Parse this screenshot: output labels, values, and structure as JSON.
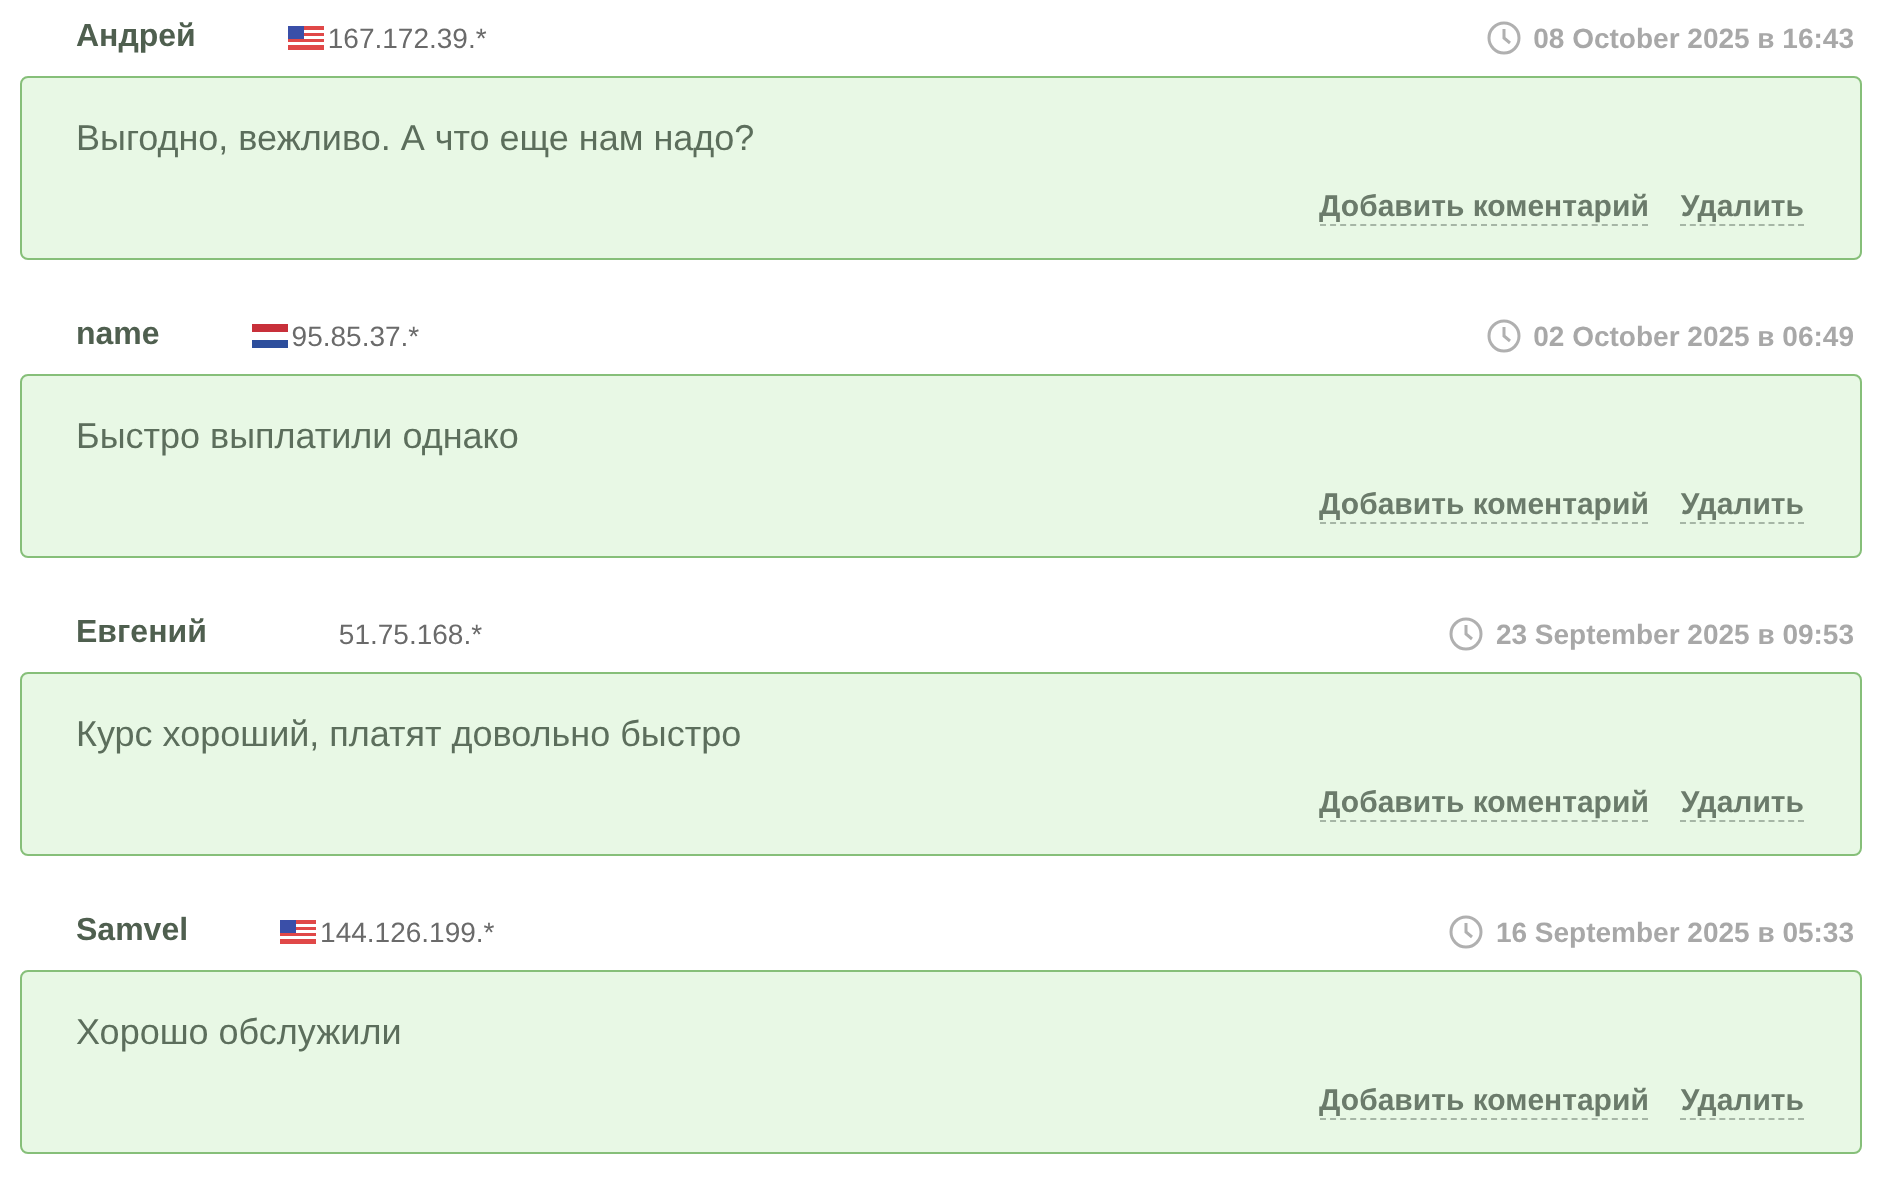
{
  "comments": [
    {
      "author": "Андрей",
      "flag": {
        "kind": "us"
      },
      "ip": "167.172.39.*",
      "date": "08 October 2025 в 16:43",
      "text": "Выгодно, вежливо. А что еще нам надо?",
      "actions": [
        "Добавить коментарий",
        "Удалить"
      ]
    },
    {
      "author": "name",
      "flag": {
        "kind": "nl"
      },
      "ip": "95.85.37.*",
      "date": "02 October 2025 в 06:49",
      "text": "Быстро выплатили однако",
      "actions": [
        "Добавить коментарий",
        "Удалить"
      ]
    },
    {
      "author": "Евгений",
      "ip": "51.75.168.*",
      "date": "23 September 2025 в 09:53",
      "text": "Курс хороший, платят довольно быстро",
      "actions": [
        "Добавить коментарий",
        "Удалить"
      ]
    },
    {
      "author": "Samvel",
      "flag": {
        "kind": "us"
      },
      "ip": "144.126.199.*",
      "date": "16 September 2025 в 05:33",
      "text": "Хорошо обслужили",
      "actions": [
        "Добавить коментарий",
        "Удалить"
      ]
    }
  ]
}
